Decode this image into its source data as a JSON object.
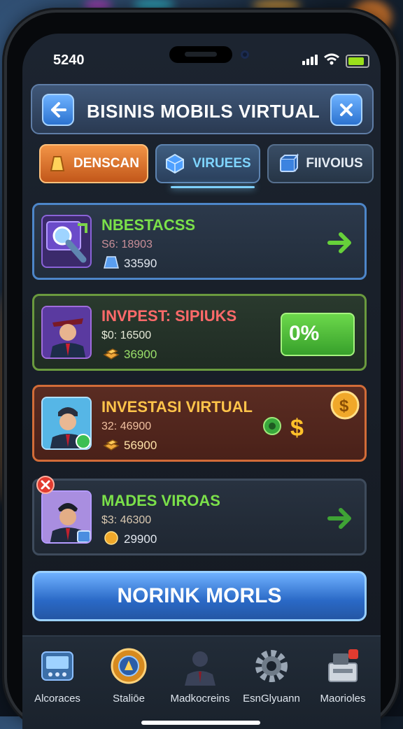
{
  "status": {
    "time": "5240"
  },
  "header": {
    "title": "BISINIS MOBILS VIRTUAL",
    "back_icon": "back-arrow-icon",
    "close_icon": "close-icon"
  },
  "tabs": [
    {
      "label": "DENSCAN",
      "icon": "gold-bar-icon",
      "active": true
    },
    {
      "label": "VIRUEES",
      "icon": "blue-gem-icon",
      "active": false
    },
    {
      "label": "FIIVOIUS",
      "icon": "blue-box-icon",
      "active": false
    }
  ],
  "cards": [
    {
      "title": "NBESTACSS",
      "value1": "S6: 18903",
      "value2": "33590",
      "title_color": "#7be04a",
      "action": "arrow-right-icon"
    },
    {
      "title": "INVPEST: SIPIUKS",
      "value1": "$0: 16500",
      "value2": "36900",
      "title_color": "#ff6a6a",
      "action_label": "0%"
    },
    {
      "title": "INVESTASI VIRTUAL",
      "value1": "32: 46900",
      "value2": "56900",
      "title_color": "#ffc44a",
      "action": "gear-dollar-icon"
    },
    {
      "title": "MADES VIROAS",
      "value1": "$3: 46300",
      "value2": "29900",
      "title_color": "#7be04a",
      "action": "arrow-right-icon"
    }
  ],
  "main_button": {
    "label": "NORINK MORLS"
  },
  "nav": [
    {
      "label": "Alcoraces",
      "icon": "device-icon"
    },
    {
      "label": "Staliōe",
      "icon": "compass-gear-icon"
    },
    {
      "label": "Madkocreins",
      "icon": "manager-icon"
    },
    {
      "label": "EsnGlyuann",
      "icon": "settings-gear-icon"
    },
    {
      "label": "Maorioles",
      "icon": "register-icon"
    }
  ]
}
